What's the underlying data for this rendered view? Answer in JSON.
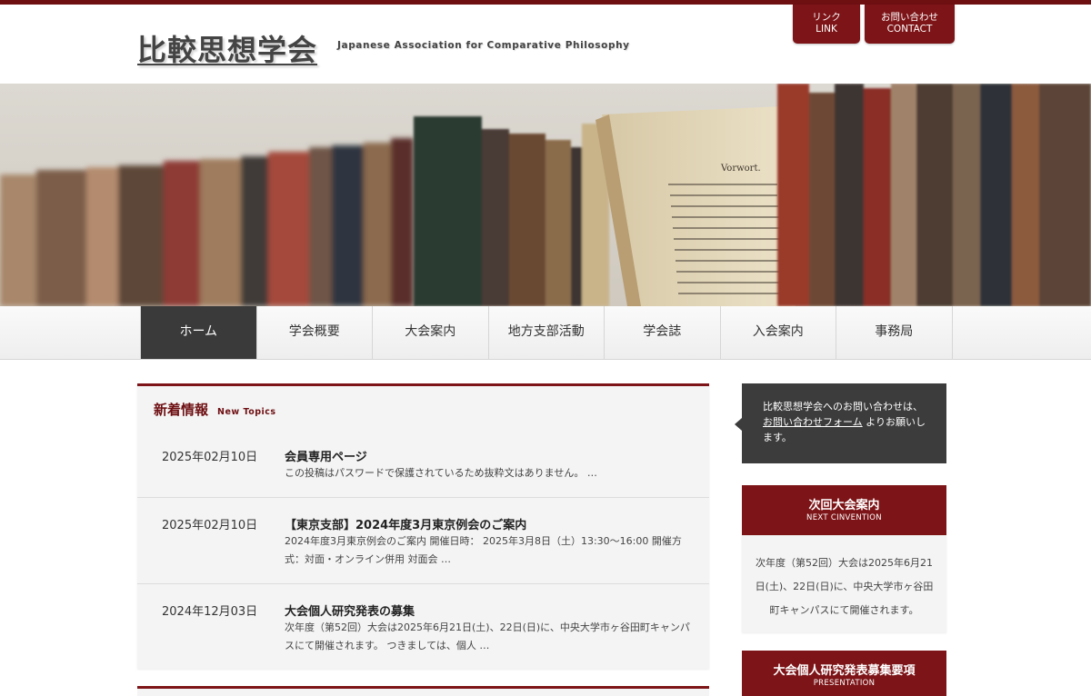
{
  "site": {
    "title": "比較思想学会",
    "subtitle": "Japanese Association for Comparative Philosophy"
  },
  "header_buttons": [
    {
      "line1": "リンク",
      "line2": "LINK"
    },
    {
      "line1": "お問い合わせ",
      "line2": "CONTACT"
    }
  ],
  "hero": {
    "book_page_heading": "Vorwort."
  },
  "nav": {
    "items": [
      {
        "label": "ホーム",
        "active": true
      },
      {
        "label": "学会概要",
        "active": false
      },
      {
        "label": "大会案内",
        "active": false
      },
      {
        "label": "地方支部活動",
        "active": false
      },
      {
        "label": "学会誌",
        "active": false
      },
      {
        "label": "入会案内",
        "active": false
      },
      {
        "label": "事務局",
        "active": false
      }
    ]
  },
  "topics": {
    "title": "新着情報",
    "subtitle": "New Topics",
    "posts": [
      {
        "date": "2025年02月10日",
        "title": "会員専用ページ",
        "excerpt": "この投稿はパスワードで保護されているため抜粋文はありません。 …"
      },
      {
        "date": "2025年02月10日",
        "title": "【東京支部】2024年度3月東京例会のご案内",
        "excerpt": "2024年度3月東京例会のご案内 開催日時： 2025年3月8日（土）13:30〜16:00 開催方式：対面・オンライン併用 対面会 …"
      },
      {
        "date": "2024年12月03日",
        "title": "大会個人研究発表の募集",
        "excerpt": "次年度（第52回）大会は2025年6月21日(土)、22日(日)に、中央大学市ヶ谷田町キャンパスにて開催されます。 つきましては、個人 …"
      }
    ]
  },
  "sidebar": {
    "contact_before": "比較思想学会へのお問い合わせは、",
    "contact_link": "お問い合わせフォーム",
    "contact_after": " よりお願いします。",
    "next_convention": {
      "title": "次回大会案内",
      "subtitle": "NEXT CINVENTION",
      "body": "次年度（第52回）大会は2025年6月21日(土)、22日(日)に、中央大学市ヶ谷田町キャンパスにて開催されます。"
    },
    "presentation": {
      "title": "大会個人研究発表募集要項",
      "subtitle": "PRESENTATION"
    }
  },
  "colors": {
    "accent": "#7d1417",
    "dark": "#3a3a3a",
    "panel": "#f4f4f4"
  }
}
